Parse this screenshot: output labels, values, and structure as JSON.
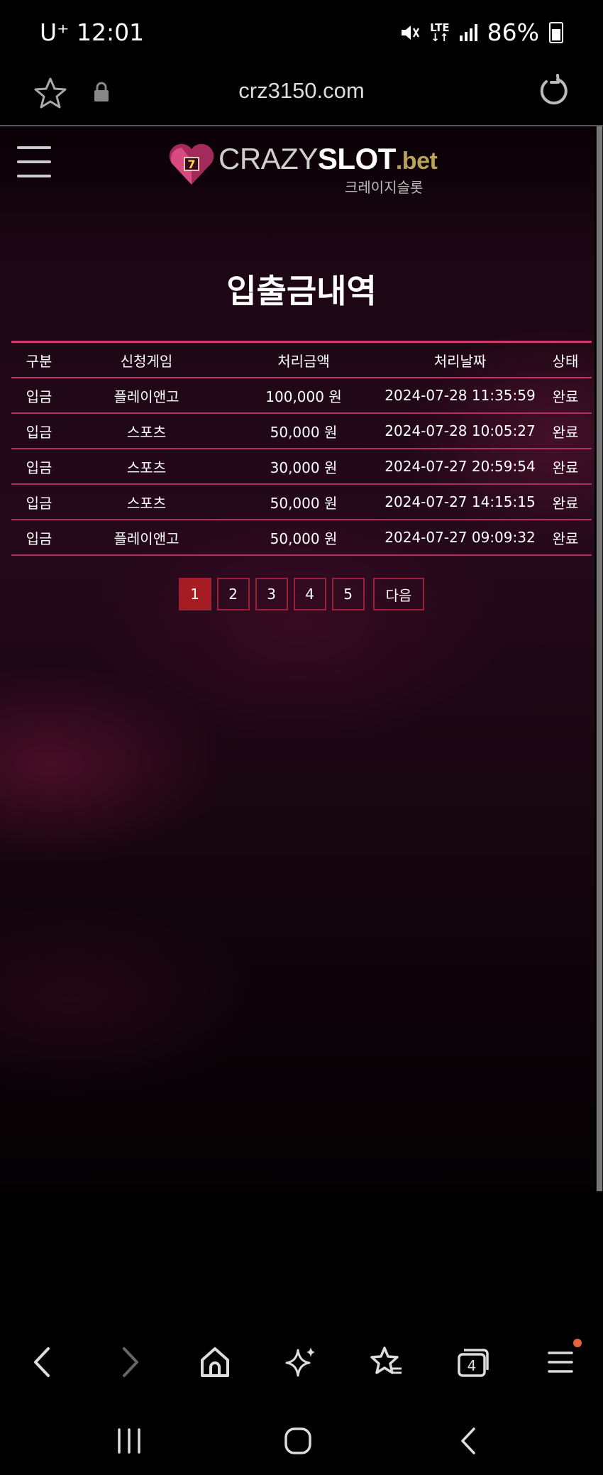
{
  "status_bar": {
    "carrier": "U⁺ 12:01",
    "network": "LTE",
    "battery": "86%"
  },
  "browser": {
    "url": "crz3150.com",
    "tab_count": "4"
  },
  "logo": {
    "brand_part1": "CRAZY",
    "brand_part2": "SLOT",
    "brand_part3": ".bet",
    "subtitle": "크레이지슬롯"
  },
  "page": {
    "title": "입출금내역"
  },
  "table": {
    "headers": [
      "구분",
      "신청게임",
      "처리금액",
      "처리날짜",
      "상태"
    ],
    "rows": [
      [
        "입금",
        "플레이앤고",
        "100,000 원",
        "2024-07-28 11:35:59",
        "완료"
      ],
      [
        "입금",
        "스포츠",
        "50,000 원",
        "2024-07-28 10:05:27",
        "완료"
      ],
      [
        "입금",
        "스포츠",
        "30,000 원",
        "2024-07-27 20:59:54",
        "완료"
      ],
      [
        "입금",
        "스포츠",
        "50,000 원",
        "2024-07-27 14:15:15",
        "완료"
      ],
      [
        "입금",
        "플레이앤고",
        "50,000 원",
        "2024-07-27 09:09:32",
        "완료"
      ]
    ]
  },
  "pagination": {
    "pages": [
      "1",
      "2",
      "3",
      "4",
      "5"
    ],
    "current": "1",
    "next_label": "다음"
  },
  "colors": {
    "accent": "#d23a6e",
    "active_page": "#a51d23",
    "brand_gold": "#b9a35a",
    "notification": "#e8623a"
  }
}
